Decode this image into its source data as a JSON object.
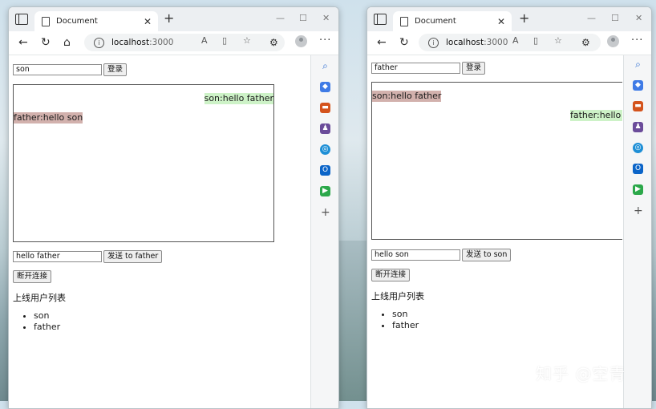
{
  "watermark": "知乎 @空青",
  "left_window": {
    "tab_title": "Document",
    "url": "localhost",
    "url_port": ":3000",
    "username_value": "son",
    "login_label": "登录",
    "messages": [
      {
        "text": "son:hello father",
        "align": "right",
        "mine": true
      },
      {
        "text": "father:hello son",
        "align": "left",
        "mine": false
      }
    ],
    "message_value": "hello father",
    "send_label": "发送 to father",
    "disconnect_label": "断开连接",
    "online_heading": "上线用户列表",
    "users": [
      "son",
      "father"
    ]
  },
  "right_window": {
    "tab_title": "Document",
    "url": "localhost",
    "url_port": ":3000",
    "username_value": "father",
    "login_label": "登录",
    "messages": [
      {
        "text": "son:hello father",
        "align": "left",
        "mine": false
      },
      {
        "text": "father:hello so",
        "align": "right",
        "mine": true
      }
    ],
    "message_value": "hello son",
    "send_label": "发送 to son",
    "disconnect_label": "断开连接",
    "online_heading": "上线用户列表",
    "users": [
      "son",
      "father"
    ]
  },
  "colors": {
    "mine_bubble": "#cdf2c7",
    "other_bubble": "#d2b1ad",
    "sidebar_icons": [
      "#2a6bd1",
      "#3f7be6",
      "#d4531c",
      "#6b4c9a",
      "#1e8fd6",
      "#0a64c8",
      "#2ba84a"
    ]
  },
  "icons": {
    "toolbar": [
      "back-icon",
      "refresh-icon",
      "home-icon",
      "read-aloud-icon",
      "immersive-reader-icon",
      "favorite-icon",
      "extensions-icon",
      "profile-icon",
      "menu-icon"
    ],
    "sidebar": [
      "search-icon",
      "shopping-icon",
      "tools-icon",
      "games-icon",
      "office-icon",
      "outlook-icon",
      "drop-icon",
      "add-icon"
    ]
  }
}
